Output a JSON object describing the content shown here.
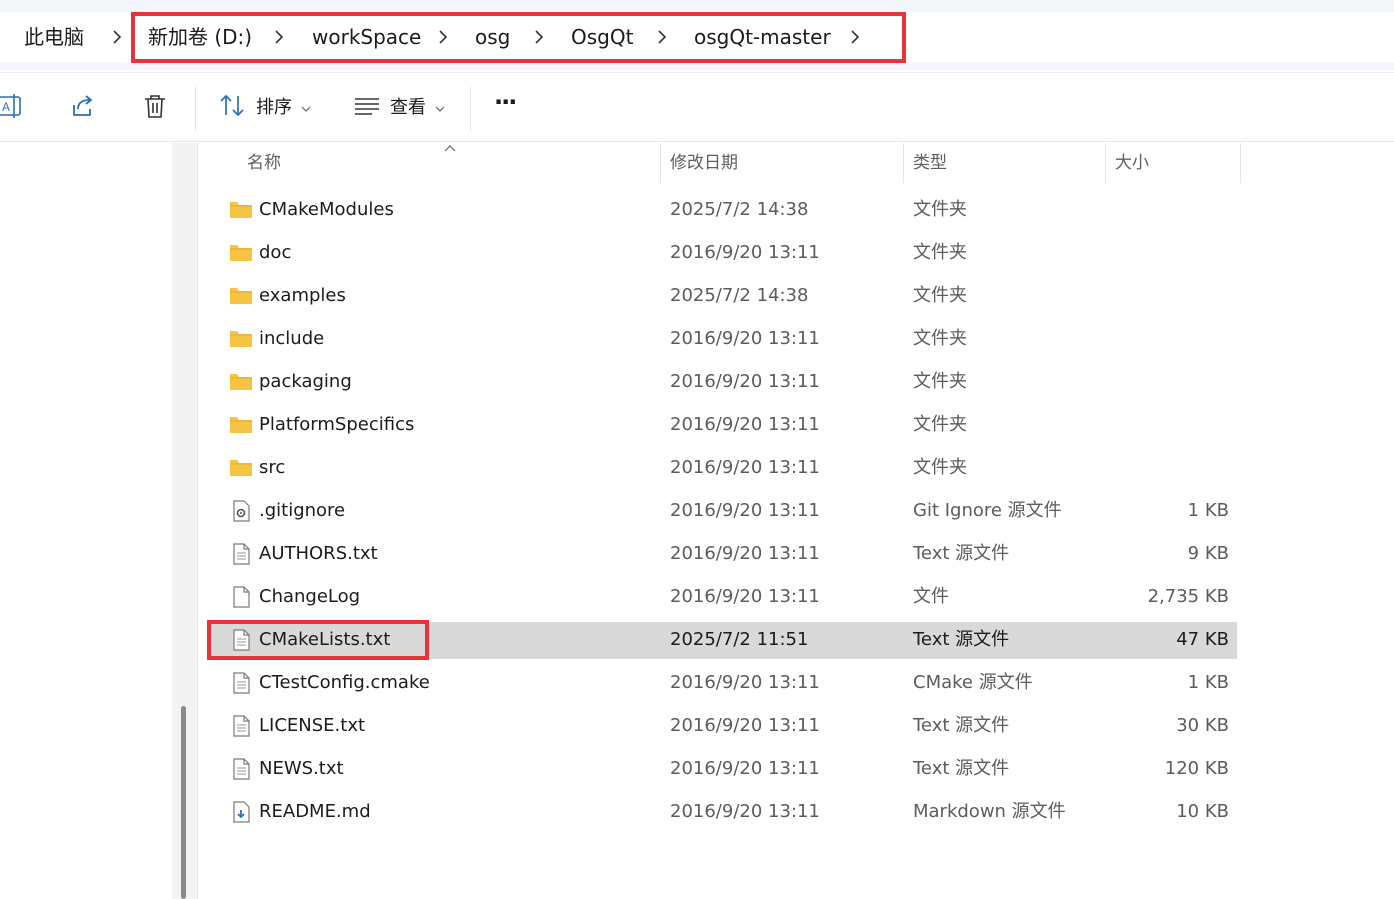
{
  "breadcrumb": {
    "root": "此电脑",
    "items": [
      "新加卷 (D:)",
      "workSpace",
      "osg",
      "OsgQt",
      "osgQt-master"
    ]
  },
  "toolbar": {
    "sort_label": "排序",
    "view_label": "查看",
    "more_label": "···"
  },
  "columns": {
    "name": "名称",
    "date": "修改日期",
    "type": "类型",
    "size": "大小"
  },
  "files": [
    {
      "name": "CMakeModules",
      "date": "2025/7/2 14:38",
      "type": "文件夹",
      "size": "",
      "icon": "folder-icon"
    },
    {
      "name": "doc",
      "date": "2016/9/20 13:11",
      "type": "文件夹",
      "size": "",
      "icon": "folder-icon"
    },
    {
      "name": "examples",
      "date": "2025/7/2 14:38",
      "type": "文件夹",
      "size": "",
      "icon": "folder-icon"
    },
    {
      "name": "include",
      "date": "2016/9/20 13:11",
      "type": "文件夹",
      "size": "",
      "icon": "folder-icon"
    },
    {
      "name": "packaging",
      "date": "2016/9/20 13:11",
      "type": "文件夹",
      "size": "",
      "icon": "folder-icon"
    },
    {
      "name": "PlatformSpecifics",
      "date": "2016/9/20 13:11",
      "type": "文件夹",
      "size": "",
      "icon": "folder-icon"
    },
    {
      "name": "src",
      "date": "2016/9/20 13:11",
      "type": "文件夹",
      "size": "",
      "icon": "folder-icon"
    },
    {
      "name": ".gitignore",
      "date": "2016/9/20 13:11",
      "type": "Git Ignore 源文件",
      "size": "1 KB",
      "icon": "gear-file-icon"
    },
    {
      "name": "AUTHORS.txt",
      "date": "2016/9/20 13:11",
      "type": "Text 源文件",
      "size": "9 KB",
      "icon": "text-file-icon"
    },
    {
      "name": "ChangeLog",
      "date": "2016/9/20 13:11",
      "type": "文件",
      "size": "2,735 KB",
      "icon": "blank-file-icon"
    },
    {
      "name": "CMakeLists.txt",
      "date": "2025/7/2 11:51",
      "type": "Text 源文件",
      "size": "47 KB",
      "icon": "text-file-icon",
      "selected": true
    },
    {
      "name": "CTestConfig.cmake",
      "date": "2016/9/20 13:11",
      "type": "CMake 源文件",
      "size": "1 KB",
      "icon": "text-file-icon"
    },
    {
      "name": "LICENSE.txt",
      "date": "2016/9/20 13:11",
      "type": "Text 源文件",
      "size": "30 KB",
      "icon": "text-file-icon"
    },
    {
      "name": "NEWS.txt",
      "date": "2016/9/20 13:11",
      "type": "Text 源文件",
      "size": "120 KB",
      "icon": "text-file-icon"
    },
    {
      "name": "README.md",
      "date": "2016/9/20 13:11",
      "type": "Markdown 源文件",
      "size": "10 KB",
      "icon": "markdown-file-icon"
    }
  ],
  "colors": {
    "highlight_box": "#e8333a",
    "selected_row": "#d9d9d9",
    "folder": "#f6c342"
  }
}
